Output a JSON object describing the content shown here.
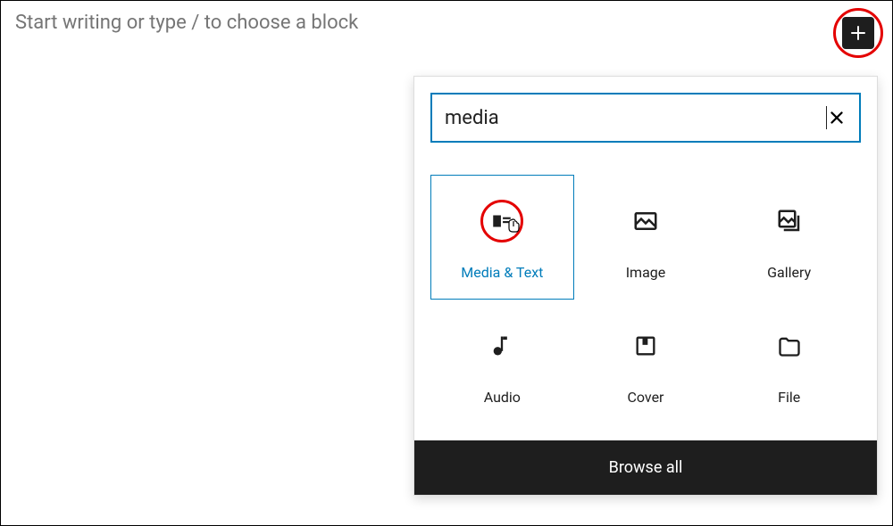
{
  "editor": {
    "placeholder": "Start writing or type / to choose a block"
  },
  "inserter": {
    "search_value": "media",
    "browse_all_label": "Browse all",
    "blocks": [
      {
        "label": "Media & Text",
        "icon": "media-text",
        "selected": true
      },
      {
        "label": "Image",
        "icon": "image",
        "selected": false
      },
      {
        "label": "Gallery",
        "icon": "gallery",
        "selected": false
      },
      {
        "label": "Audio",
        "icon": "audio",
        "selected": false
      },
      {
        "label": "Cover",
        "icon": "cover",
        "selected": false
      },
      {
        "label": "File",
        "icon": "file",
        "selected": false
      }
    ]
  }
}
